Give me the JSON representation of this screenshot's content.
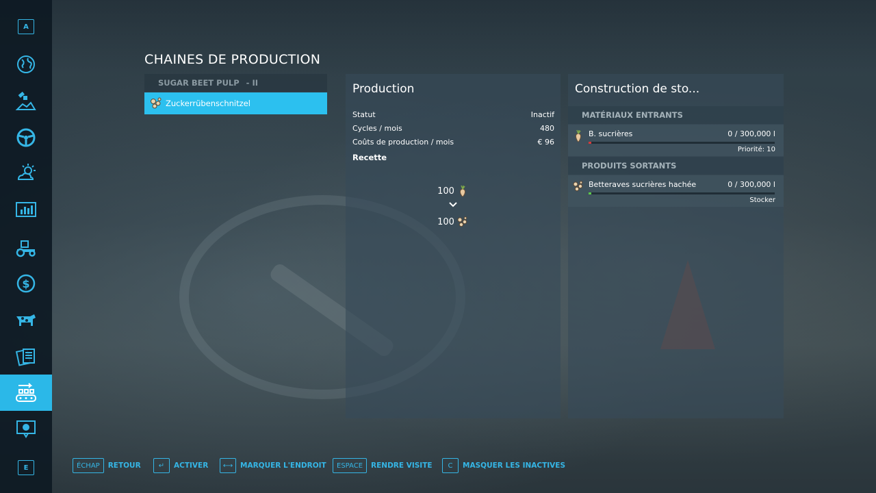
{
  "sidebar": {
    "top_key": "A",
    "bottom_key": "E",
    "items": [
      {
        "icon": "globe-icon"
      },
      {
        "icon": "satellite-icon"
      },
      {
        "icon": "steering-wheel-icon"
      },
      {
        "icon": "weather-icon"
      },
      {
        "icon": "statistics-icon"
      },
      {
        "icon": "tractor-icon"
      },
      {
        "icon": "dollar-icon"
      },
      {
        "icon": "cow-icon"
      },
      {
        "icon": "contracts-icon"
      },
      {
        "icon": "production-icon",
        "active": true
      },
      {
        "icon": "help-icon"
      }
    ]
  },
  "page_title": "CHAINES DE PRODUCTION",
  "chains": {
    "group_name": "SUGAR BEET PULP",
    "group_level": "- II",
    "selected_item": "Zuckerrübenschnitzel"
  },
  "production": {
    "title": "Production",
    "rows": [
      {
        "label": "Statut",
        "value": "Inactif"
      },
      {
        "label": "Cycles / mois",
        "value": "480"
      },
      {
        "label": "Coûts de production / mois",
        "value": "€ 96"
      }
    ],
    "recipe_title": "Recette",
    "recipe_input_amount": "100",
    "recipe_output_amount": "100"
  },
  "storage": {
    "title": "Construction de sto...",
    "inputs_header": "MATÉRIAUX ENTRANTS",
    "input": {
      "name": "B. sucrières",
      "value": "0  / 300,000 l",
      "note": "Priorité: 10",
      "fill_fraction": 0.0,
      "bar_color": "#d63a3a"
    },
    "outputs_header": "PRODUITS SORTANTS",
    "output": {
      "name": "Betteraves sucrières hachée",
      "value": "0  / 300,000 l",
      "note": "Stocker",
      "fill_fraction": 0.0,
      "bar_color": "#5cc84a"
    }
  },
  "hints": [
    {
      "key": "ÉCHAP",
      "label": "RETOUR"
    },
    {
      "key": "↵",
      "label": "ACTIVER"
    },
    {
      "key": "⟷",
      "label": "MARQUER L'ENDROIT"
    },
    {
      "key": "ESPACE",
      "label": "RENDRE VISITE"
    },
    {
      "key": "C",
      "label": "MASQUER LES INACTIVES"
    }
  ],
  "colors": {
    "accent": "#2bb8e8"
  }
}
